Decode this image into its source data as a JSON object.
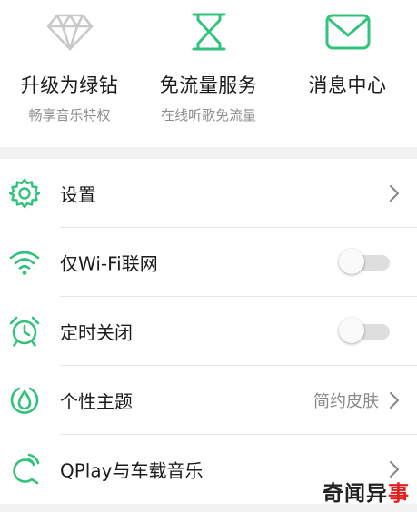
{
  "colors": {
    "accent": "#31c27c",
    "diamond": "#c9c9c9",
    "text": "#1c1c1c",
    "subtext": "#8e8e8e",
    "watermark_red": "#e02020"
  },
  "features": [
    {
      "icon": "diamond-icon",
      "title": "升级为绿钻",
      "subtitle": "畅享音乐特权"
    },
    {
      "icon": "hourglass-icon",
      "title": "免流量服务",
      "subtitle": "在线听歌免流量"
    },
    {
      "icon": "mail-icon",
      "title": "消息中心",
      "subtitle": ""
    }
  ],
  "settings": [
    {
      "icon": "gear-icon",
      "label": "设置",
      "control": "chevron"
    },
    {
      "icon": "wifi-icon",
      "label": "仅Wi-Fi联网",
      "control": "toggle",
      "on": false
    },
    {
      "icon": "alarm-clock-icon",
      "label": "定时关闭",
      "control": "toggle",
      "on": false
    },
    {
      "icon": "theme-icon",
      "label": "个性主题",
      "value": "简约皮肤",
      "control": "chevron"
    },
    {
      "icon": "qplay-icon",
      "label": "QPlay与车载音乐",
      "control": "chevron"
    }
  ],
  "watermark": {
    "part1": "奇闻异",
    "part2": "事"
  }
}
